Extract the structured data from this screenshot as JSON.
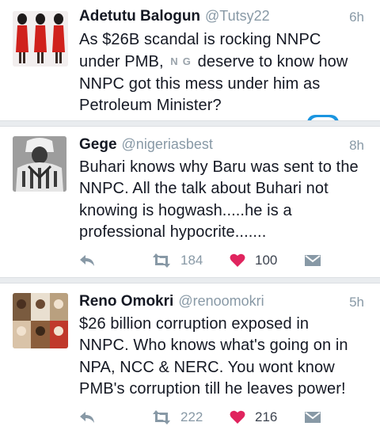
{
  "tweets": [
    {
      "name": "Adetutu Balogun",
      "handle": "@Tutsy22",
      "time": "6h",
      "text_lead": "As $26B scandal is rocking NNPC under PMB,",
      "emoji": [
        "N",
        "G"
      ],
      "text_rest": "deserve to know how NNPC got this mess under him as Petroleum Minister?",
      "avatar": "avatar-photo"
    },
    {
      "name": "Gege",
      "handle": "@nigeriasbest",
      "time": "8h",
      "text": "Buhari knows why Baru was sent to the NNPC. All the talk about Buhari not knowing is hogwash.....he is a professional hypocrite.......",
      "retweets": "184",
      "likes": "100",
      "avatar": "avatar-photo"
    },
    {
      "name": "Reno Omokri",
      "handle": "@renoomokri",
      "time": "5h",
      "text": "$26 billion corruption exposed in NNPC. Who knows what's going on in NPA, NCC & NERC. You wont know PMB's corruption till he leaves power!",
      "retweets": "222",
      "likes": "216",
      "avatar": "avatar-photo"
    }
  ],
  "icons": {
    "reply": "reply-icon",
    "retweet": "retweet-icon",
    "like": "heart-icon",
    "dm": "direct-message-icon"
  },
  "colors": {
    "like": "#e0245e",
    "muted": "#8899a6",
    "accent": "#1b95e0"
  }
}
